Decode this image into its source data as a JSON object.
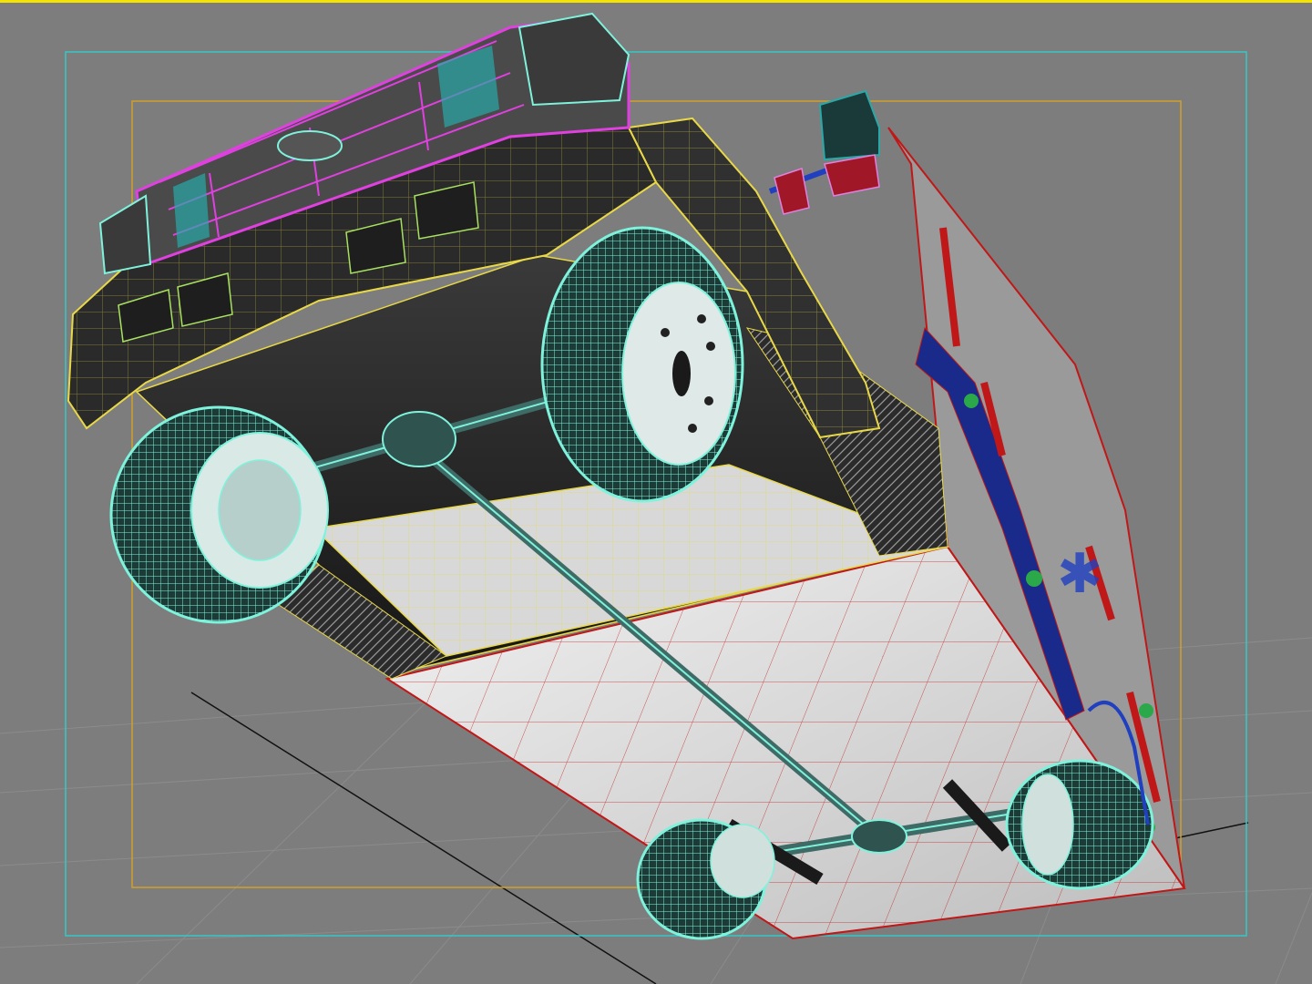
{
  "viewport": {
    "view": "perspective-bottom",
    "shading": "smooth-highlights-edged-faces",
    "active_border_color": "#f2e400",
    "background_color": "#7d7d7d",
    "grid_color": "#8a8a8a",
    "safe_frame_outer_color": "#36c8c8",
    "safe_frame_inner_color": "#d2a02a"
  },
  "model": {
    "object": "ambulance",
    "wire_colors": {
      "tires": "#7ff2dc",
      "grille": "#e040e0",
      "body": "#e8d848",
      "box": "#c01818",
      "mirror": "#2aa8a8",
      "accent": "#2040c0"
    },
    "icons": [
      "ambulance-model",
      "wheel-icon",
      "mirror-icon",
      "drive-shaft-icon"
    ]
  }
}
